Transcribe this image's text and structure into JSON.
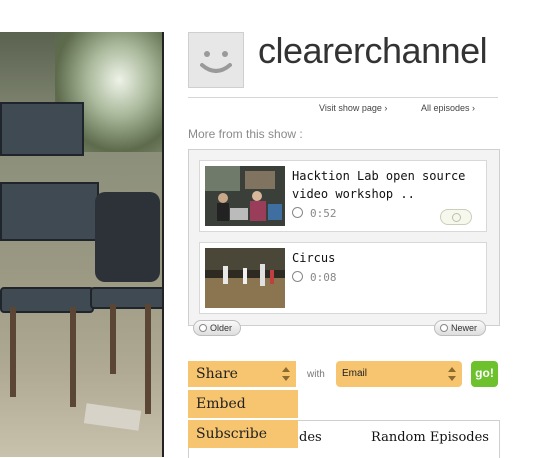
{
  "channel": {
    "name": "clearerchannel"
  },
  "links": {
    "visit_show_page": "Visit show page ›",
    "all_episodes": "All episodes ›"
  },
  "more_from_show": {
    "title": "More from this show :"
  },
  "episodes": [
    {
      "title": "Hacktion Lab open source video workshop ..",
      "duration": "0:52"
    },
    {
      "title": "Circus",
      "duration": "0:08"
    }
  ],
  "pager": {
    "older": "Older",
    "newer": "Newer"
  },
  "share": {
    "selected": "Share",
    "with_label": "with",
    "method_selected": "Email",
    "go_label": "go!",
    "options": [
      "Embed",
      "Subscribe"
    ]
  },
  "tabs": {
    "partial_label": "des",
    "random_episodes": "Random Episodes"
  },
  "colors": {
    "accent": "#f7c56f",
    "go_button": "#6cc12c"
  }
}
